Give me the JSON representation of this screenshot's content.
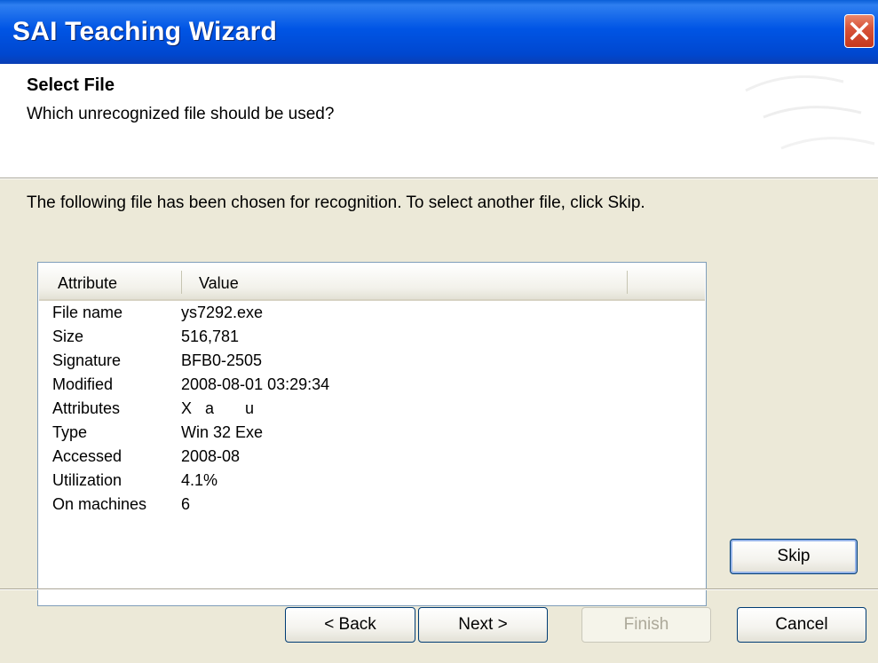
{
  "window": {
    "title": "SAI Teaching Wizard"
  },
  "header": {
    "title": "Select File",
    "subtitle": "Which unrecognized file should be used?"
  },
  "intro": "The following file has been chosen for recognition.  To select another file, click Skip.",
  "list": {
    "columns": [
      "Attribute",
      "Value"
    ],
    "rows": [
      {
        "attribute": "File name",
        "value": "ys7292.exe"
      },
      {
        "attribute": "Size",
        "value": "516,781"
      },
      {
        "attribute": "Signature",
        "value": "BFB0-2505"
      },
      {
        "attribute": "Modified",
        "value": "2008-08-01 03:29:34"
      },
      {
        "attribute": "Attributes",
        "value": "X   a       u"
      },
      {
        "attribute": "Type",
        "value": "Win 32 Exe"
      },
      {
        "attribute": "Accessed",
        "value": "2008-08"
      },
      {
        "attribute": "Utilization",
        "value": "4.1%"
      },
      {
        "attribute": "On machines",
        "value": "6"
      }
    ]
  },
  "buttons": {
    "skip": "Skip",
    "back": "< Back",
    "next": "Next >",
    "finish": "Finish",
    "cancel": "Cancel"
  },
  "icons": {
    "close": "close-icon"
  },
  "colors": {
    "titlebar": "#0055e5",
    "close": "#d8543a",
    "face": "#ece9d8"
  }
}
